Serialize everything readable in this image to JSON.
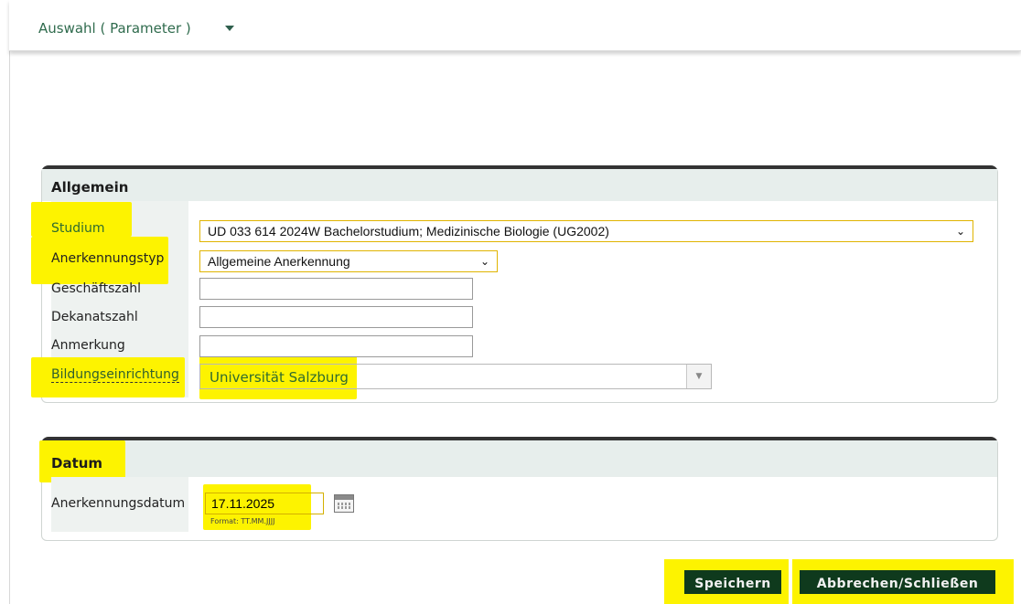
{
  "topbar": {
    "title": "Auswahl ( Parameter )"
  },
  "allgemein": {
    "title": "Allgemein",
    "fields": {
      "studium": {
        "label": "Studium",
        "value": "UD 033 614 2024W Bachelorstudium; Medizinische Biologie (UG2002)"
      },
      "anerkennungstyp": {
        "label": "Anerkennungstyp",
        "value": "Allgemeine Anerkennung"
      },
      "geschaeftszahl": {
        "label": "Geschäftszahl",
        "value": ""
      },
      "dekanatszahl": {
        "label": "Dekanatszahl",
        "value": ""
      },
      "anmerkung": {
        "label": "Anmerkung",
        "value": ""
      },
      "bildungseinrichtung": {
        "label": "Bildungseinrichtung",
        "value": "Universität Salzburg"
      }
    }
  },
  "datum": {
    "title": "Datum",
    "anerkennungsdatum": {
      "label": "Anerkennungsdatum",
      "value": "17.11.2025",
      "hint": "Format: TT.MM.JJJJ"
    }
  },
  "actions": {
    "save": "Speichern",
    "cancel": "Abbrechen/Schließen"
  },
  "icons": {
    "dropdown": "chevron-down-icon",
    "calendar": "calendar-icon",
    "combo": "triangle-down-icon"
  },
  "colors": {
    "highlight": "#fdf300",
    "button_bg": "#0f3a1d",
    "header_bg": "#e7eeec"
  }
}
